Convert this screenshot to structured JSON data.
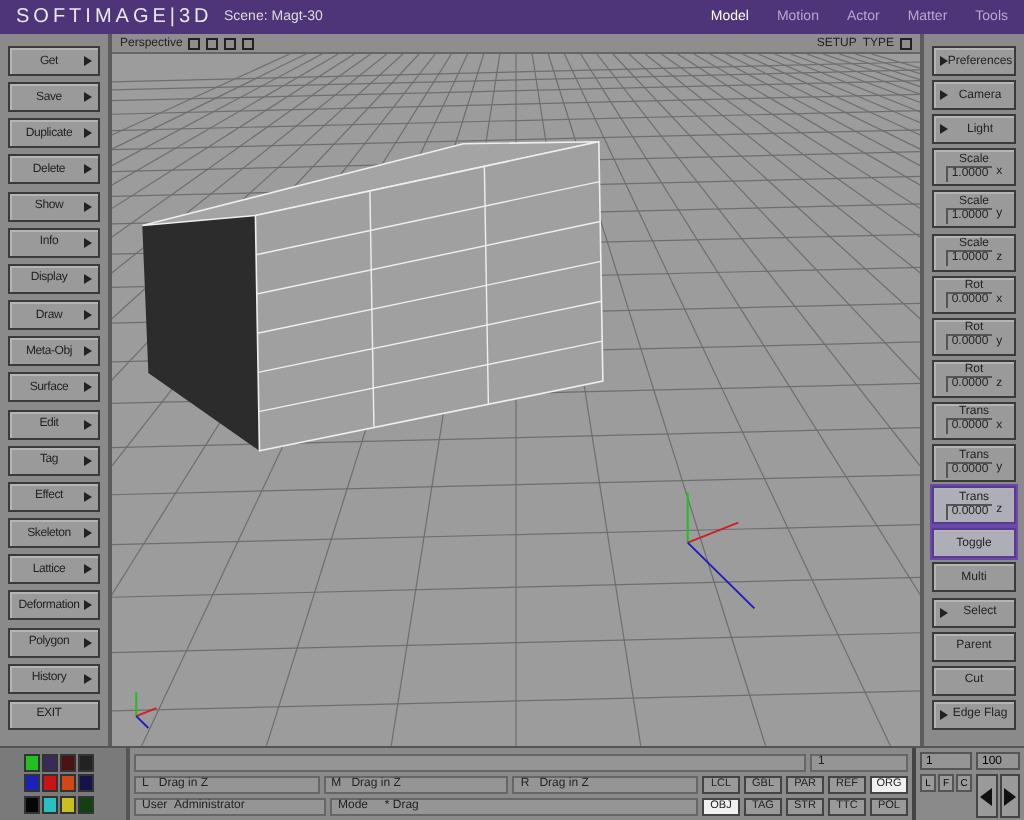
{
  "title_bar": {
    "logo": "SOFTIMAGE|3D",
    "scene": "Scene: Magt-30",
    "modules": [
      {
        "label": "Model",
        "selected": true
      },
      {
        "label": "Motion",
        "selected": false
      },
      {
        "label": "Actor",
        "selected": false
      },
      {
        "label": "Matter",
        "selected": false
      },
      {
        "label": "Tools",
        "selected": false
      }
    ]
  },
  "left_menu": [
    {
      "label": "Get",
      "kind": "menu"
    },
    {
      "label": "Save",
      "kind": "menu"
    },
    {
      "label": "Duplicate",
      "kind": "menu"
    },
    {
      "label": "Delete",
      "kind": "menu"
    },
    {
      "label": "Show",
      "kind": "menu"
    },
    {
      "label": "Info",
      "kind": "menu"
    },
    {
      "label": "Display",
      "kind": "menu"
    },
    {
      "label": "Draw",
      "kind": "menu"
    },
    {
      "label": "Meta-Obj",
      "kind": "menu"
    },
    {
      "label": "Surface",
      "kind": "menu"
    },
    {
      "label": "Edit",
      "kind": "menu"
    },
    {
      "label": "Tag",
      "kind": "menu"
    },
    {
      "label": "Effect",
      "kind": "menu"
    },
    {
      "label": "Skeleton",
      "kind": "menu"
    },
    {
      "label": "Lattice",
      "kind": "menu"
    },
    {
      "label": "Deformation",
      "kind": "menu"
    },
    {
      "label": "Polygon",
      "kind": "menu"
    },
    {
      "label": "History",
      "kind": "menu"
    },
    {
      "label": "EXIT",
      "kind": "plain"
    }
  ],
  "viewport": {
    "view": "Perspective",
    "setup": "SETUP",
    "type": "TYPE"
  },
  "right_menu": [
    {
      "label": "Preferences",
      "kind": "menu",
      "selected": false
    },
    {
      "label": "Camera",
      "kind": "menu",
      "selected": false
    },
    {
      "label": "Light",
      "kind": "menu",
      "selected": false
    },
    {
      "label": "Scale",
      "value": "1.0000",
      "axis": "x",
      "kind": "field",
      "selected": false
    },
    {
      "label": "Scale",
      "value": "1.0000",
      "axis": "y",
      "kind": "field",
      "selected": false
    },
    {
      "label": "Scale",
      "value": "1.0000",
      "axis": "z",
      "kind": "field",
      "selected": false
    },
    {
      "label": "Rot",
      "value": "0.0000",
      "axis": "x",
      "kind": "field",
      "selected": false
    },
    {
      "label": "Rot",
      "value": "0.0000",
      "axis": "y",
      "kind": "field",
      "selected": false
    },
    {
      "label": "Rot",
      "value": "0.0000",
      "axis": "z",
      "kind": "field",
      "selected": false
    },
    {
      "label": "Trans",
      "value": "0.0000",
      "axis": "x",
      "kind": "field",
      "selected": false
    },
    {
      "label": "Trans",
      "value": "0.0000",
      "axis": "y",
      "kind": "field",
      "selected": false
    },
    {
      "label": "Trans",
      "value": "0.0000",
      "axis": "z",
      "kind": "field",
      "selected": true
    },
    {
      "label": "Toggle",
      "kind": "plain",
      "selected": true
    },
    {
      "label": "Multi",
      "kind": "plain",
      "selected": false
    },
    {
      "label": "Select",
      "kind": "menu",
      "selected": false
    },
    {
      "label": "Parent",
      "kind": "plain",
      "selected": false
    },
    {
      "label": "Cut",
      "kind": "plain",
      "selected": false
    },
    {
      "label": "Edge Flag",
      "kind": "menu",
      "selected": false
    }
  ],
  "palette": [
    {
      "color": "#22c022"
    },
    {
      "color": "#3a2a5a"
    },
    {
      "color": "#4a1414"
    },
    {
      "color": "#222222"
    },
    {
      "color": "#1a22b8"
    },
    {
      "color": "#c81414"
    },
    {
      "color": "#d04814"
    },
    {
      "color": "#141448"
    },
    {
      "color": "#060606"
    },
    {
      "color": "#28c0c0"
    },
    {
      "color": "#c8c020"
    },
    {
      "color": "#124012"
    }
  ],
  "command_line": {
    "frame": "1"
  },
  "mouse": [
    {
      "button": "L",
      "action": "Drag in Z"
    },
    {
      "button": "M",
      "action": "Drag in Z"
    },
    {
      "button": "R",
      "action": "Drag in Z"
    }
  ],
  "status": {
    "user_label": "User",
    "user": "Administrator",
    "mode_label": "Mode",
    "mode": "* Drag"
  },
  "ref_buttons": [
    [
      {
        "label": "LCL",
        "selected": false
      },
      {
        "label": "GBL",
        "selected": false
      },
      {
        "label": "PAR",
        "selected": false
      },
      {
        "label": "REF",
        "selected": false
      },
      {
        "label": "ORG",
        "selected": true
      }
    ],
    [
      {
        "label": "OBJ",
        "selected": true
      },
      {
        "label": "TAG",
        "selected": false
      },
      {
        "label": "STR",
        "selected": false
      },
      {
        "label": "TTC",
        "selected": false
      },
      {
        "label": "POL",
        "selected": false
      }
    ]
  ],
  "timeline": {
    "start": "1",
    "end": "100",
    "keys": [
      "L",
      "F",
      "C"
    ]
  }
}
